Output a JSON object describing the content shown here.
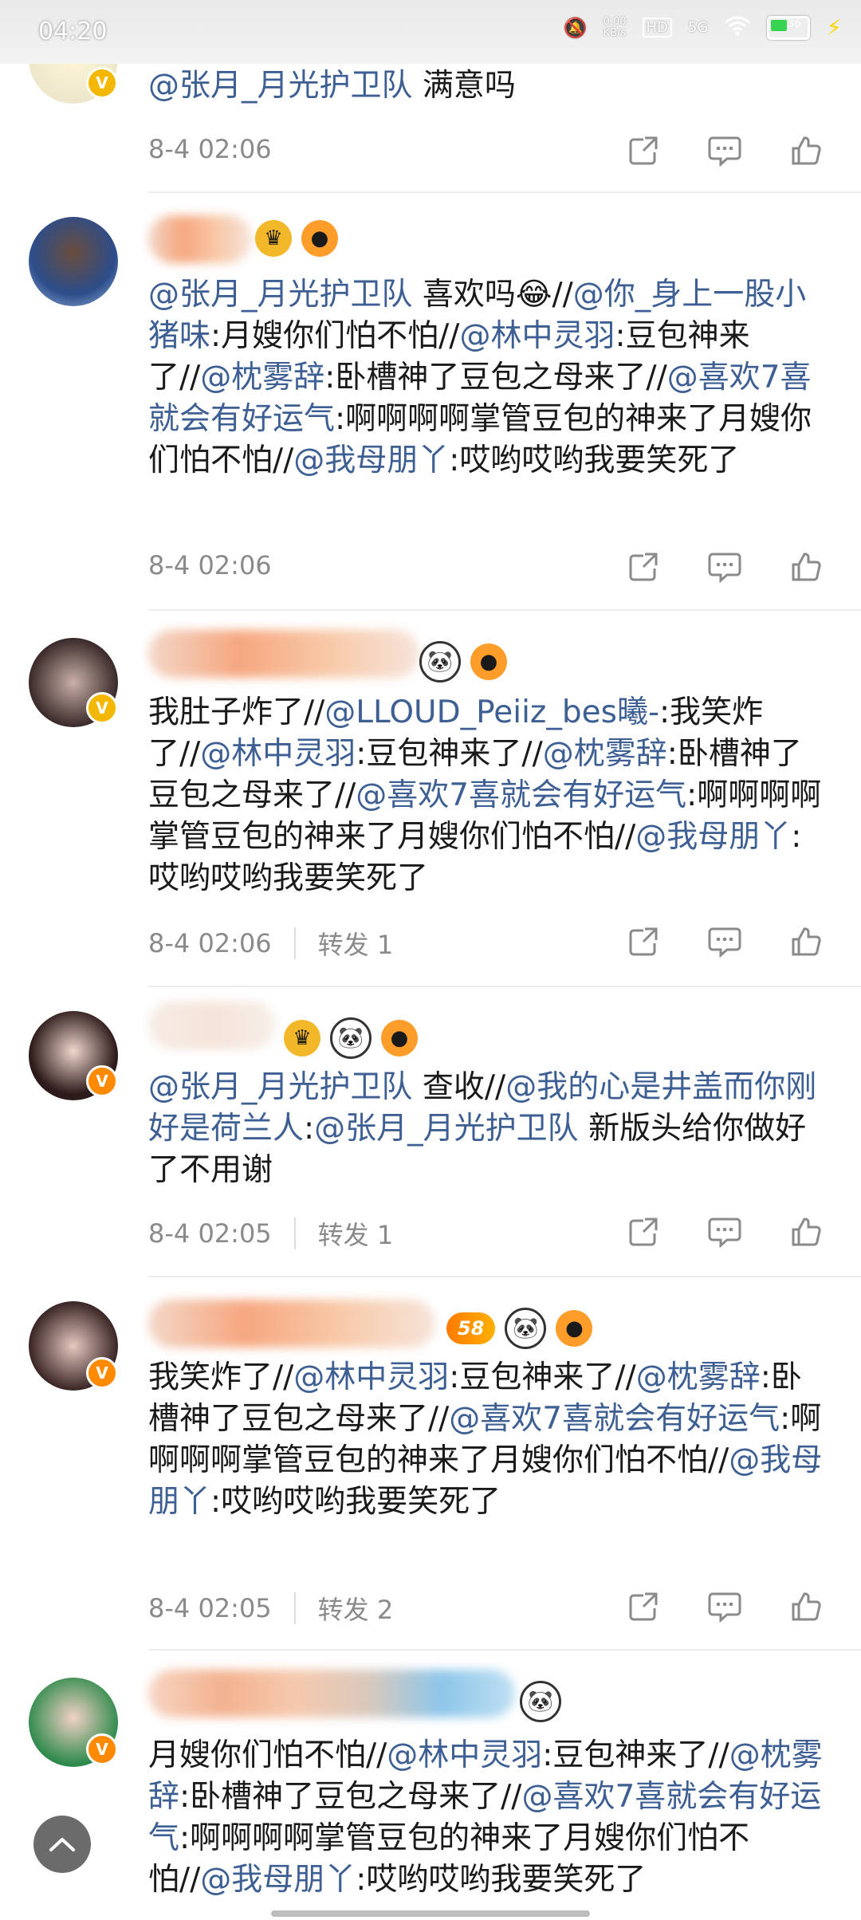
{
  "status_bar": {
    "time": "04:20",
    "network_speed": "0.00\nKB/s",
    "hd_label": "HD",
    "signal_label": "5G",
    "battery": "36"
  },
  "comments": [
    {
      "avatar_badge": "V",
      "text_parts": [
        {
          "t": "@张月_月光护卫队",
          "m": true
        },
        {
          "t": " 满意吗",
          "m": false
        }
      ],
      "date": "8-4 02:06",
      "repost": ""
    },
    {
      "avatar_badge": "",
      "text_parts": [
        {
          "t": "@张月_月光护卫队",
          "m": true
        },
        {
          "t": " 喜欢吗😂//",
          "m": false
        },
        {
          "t": "@你_身上一股小猪味",
          "m": true
        },
        {
          "t": ":月嫂你们怕不怕//",
          "m": false
        },
        {
          "t": "@林中灵羽",
          "m": true
        },
        {
          "t": ":豆包神来了//",
          "m": false
        },
        {
          "t": "@枕雾辞",
          "m": true
        },
        {
          "t": ":卧槽神了豆包之母来了//",
          "m": false
        },
        {
          "t": "@喜欢7喜就会有好运气",
          "m": true
        },
        {
          "t": ":啊啊啊啊掌管豆包的神来了月嫂你们怕不怕//",
          "m": false
        },
        {
          "t": "@我母朋丫",
          "m": true
        },
        {
          "t": ":哎哟哎哟我要笑死了",
          "m": false
        }
      ],
      "date": "8-4 02:06",
      "repost": ""
    },
    {
      "avatar_badge": "V",
      "text_parts": [
        {
          "t": "我肚子炸了//",
          "m": false
        },
        {
          "t": "@LLOUD_Peiiz_bes曦-",
          "m": true
        },
        {
          "t": ":我笑炸了//",
          "m": false
        },
        {
          "t": "@林中灵羽",
          "m": true
        },
        {
          "t": ":豆包神来了//",
          "m": false
        },
        {
          "t": "@枕雾辞",
          "m": true
        },
        {
          "t": ":卧槽神了豆包之母来了//",
          "m": false
        },
        {
          "t": "@喜欢7喜就会有好运气",
          "m": true
        },
        {
          "t": ":啊啊啊啊掌管豆包的神来了月嫂你们怕不怕//",
          "m": false
        },
        {
          "t": "@我母朋丫",
          "m": true
        },
        {
          "t": ":哎哟哎哟我要笑死了",
          "m": false
        }
      ],
      "date": "8-4 02:06",
      "repost": "转发 1"
    },
    {
      "avatar_badge": "V",
      "text_parts": [
        {
          "t": "@张月_月光护卫队",
          "m": true
        },
        {
          "t": " 查收//",
          "m": false
        },
        {
          "t": "@我的心是井盖而你刚好是荷兰人",
          "m": true
        },
        {
          "t": ":",
          "m": false
        },
        {
          "t": "@张月_月光护卫队",
          "m": true
        },
        {
          "t": " 新版头给你做好了不用谢",
          "m": false
        }
      ],
      "date": "8-4 02:05",
      "repost": "转发 1"
    },
    {
      "avatar_badge": "V",
      "level": "58",
      "text_parts": [
        {
          "t": "我笑炸了//",
          "m": false
        },
        {
          "t": "@林中灵羽",
          "m": true
        },
        {
          "t": ":豆包神来了//",
          "m": false
        },
        {
          "t": "@枕雾辞",
          "m": true
        },
        {
          "t": ":卧槽神了豆包之母来了//",
          "m": false
        },
        {
          "t": "@喜欢7喜就会有好运气",
          "m": true
        },
        {
          "t": ":啊啊啊啊掌管豆包的神来了月嫂你们怕不怕//",
          "m": false
        },
        {
          "t": "@我母朋丫",
          "m": true
        },
        {
          "t": ":哎哟哎哟我要笑死了",
          "m": false
        }
      ],
      "date": "8-4 02:05",
      "repost": "转发 2"
    },
    {
      "avatar_badge": "V",
      "text_parts": [
        {
          "t": "月嫂你们怕不怕//",
          "m": false
        },
        {
          "t": "@林中灵羽",
          "m": true
        },
        {
          "t": ":豆包神来了//",
          "m": false
        },
        {
          "t": "@枕雾辞",
          "m": true
        },
        {
          "t": ":卧槽神了豆包之母来了//",
          "m": false
        },
        {
          "t": "@喜欢7喜就会有好运气",
          "m": true
        },
        {
          "t": ":啊啊啊啊掌管豆包的神来了月嫂你们怕不怕//",
          "m": false
        },
        {
          "t": "@我母朋丫",
          "m": true
        },
        {
          "t": ":哎哟哎哟我要笑死了",
          "m": false
        }
      ],
      "date": "",
      "repost": ""
    }
  ],
  "icons": {
    "share": "share-icon",
    "comment": "comment-icon",
    "like": "like-icon",
    "scroll_top": "chevron-up-icon"
  },
  "colors": {
    "mention": "#3d5f93",
    "meta": "#8a8a8a",
    "v_gold": "#f5b800",
    "v_orange": "#ff8a00"
  }
}
